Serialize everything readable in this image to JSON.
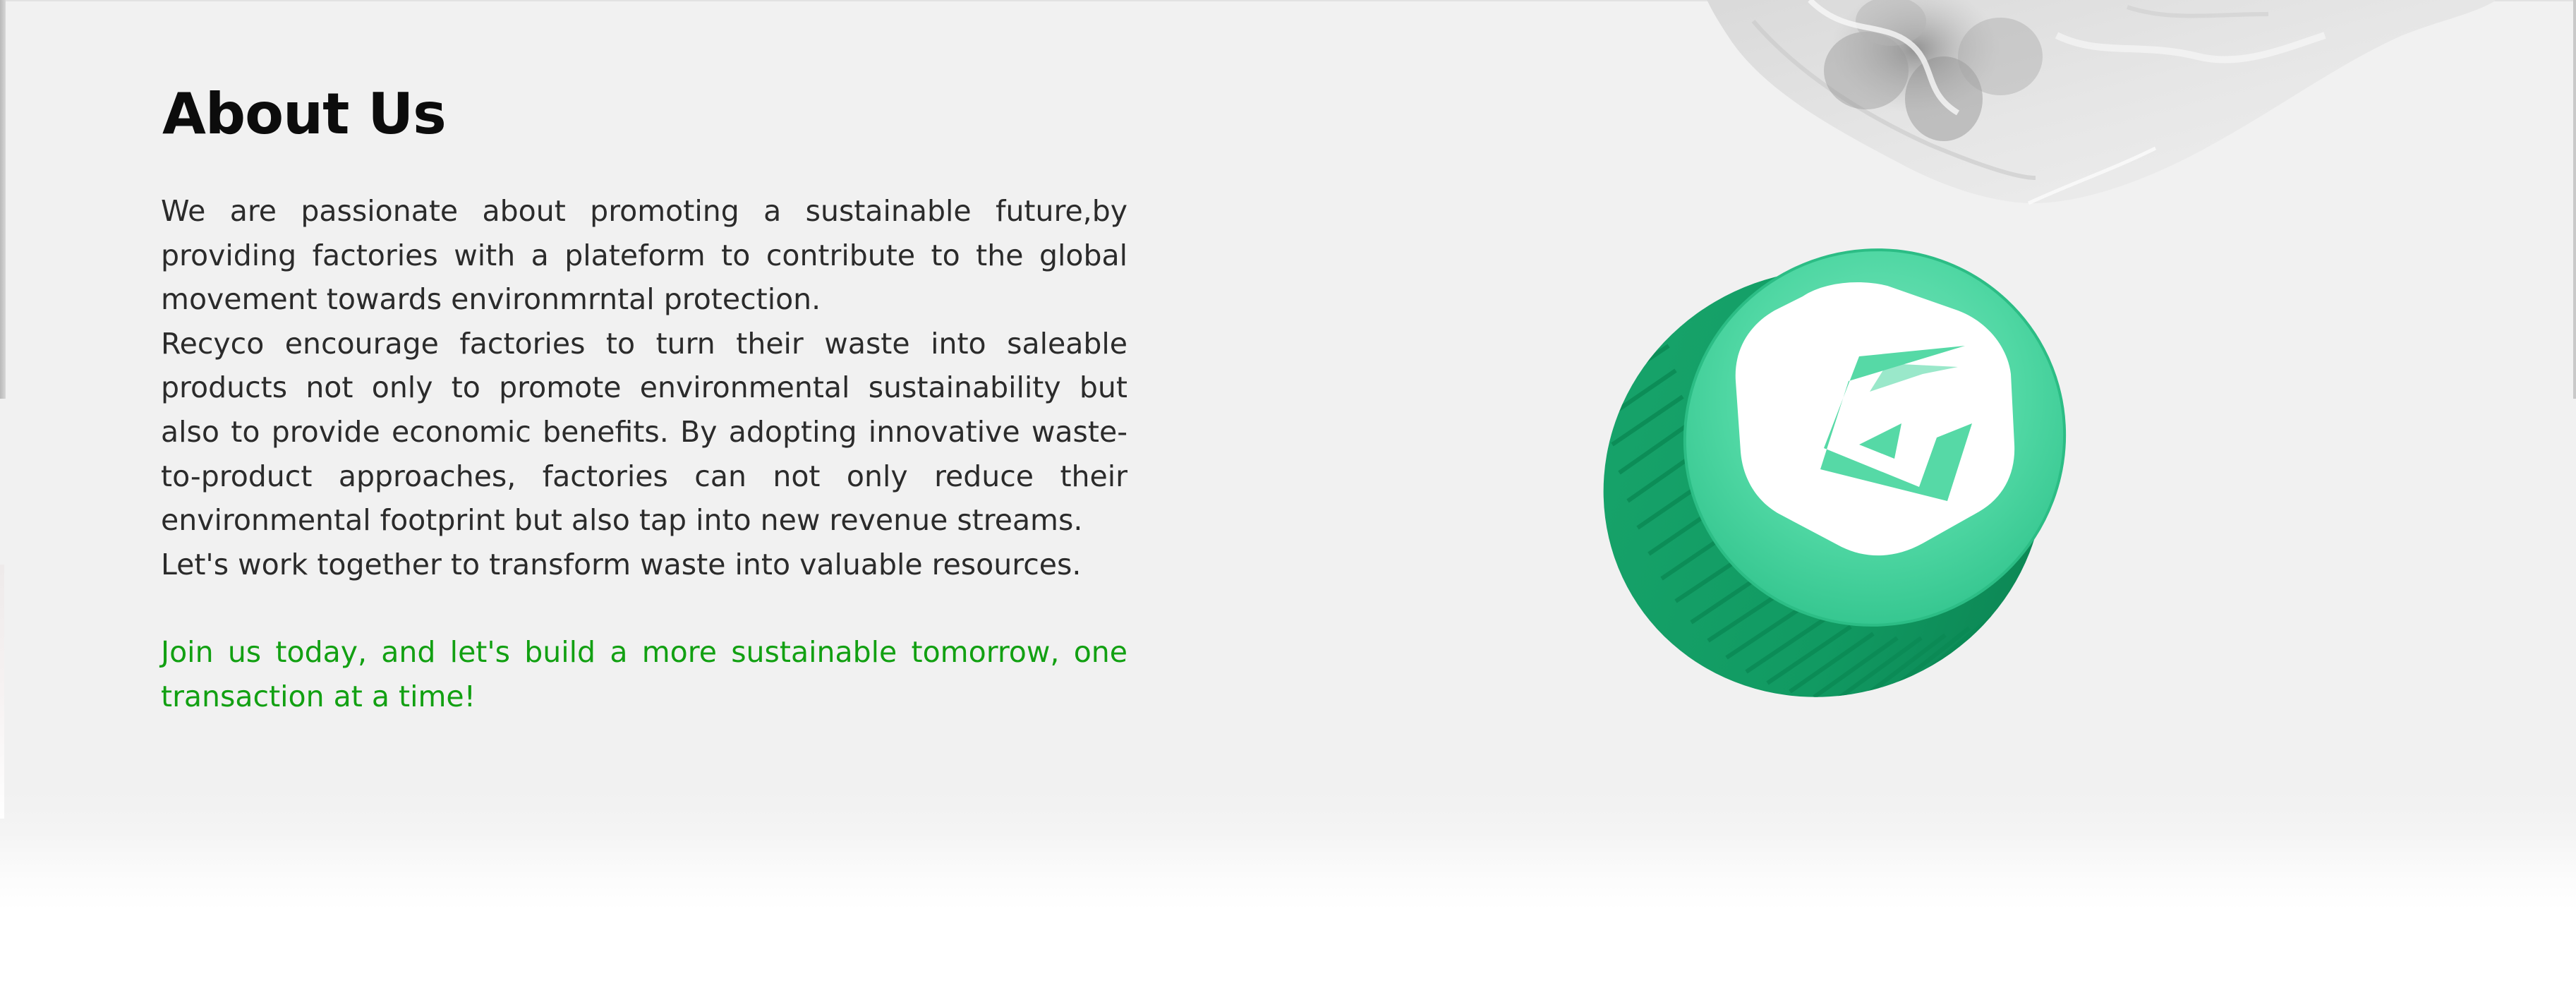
{
  "about": {
    "title": "About Us",
    "paragraphs": [
      "We are passionate about promoting a sustainable future,by providing factories with a plateform to contribute to the global movement towards environmrntal protection.",
      "Recyco encourage factories to turn their waste into saleable products not only to promote environmental sustainability but also to provide economic benefits. By adopting innovative waste-to-product approaches, factories can not only reduce their environmental footprint but also tap into new revenue streams.",
      "Let's work together to transform waste into valuable resources."
    ],
    "cta": "Join us today, and let's build a more sustainable tomorrow, one transaction at a time!"
  },
  "images": {
    "bag": "crumpled-plastic-bag-image",
    "cap": "green-bottle-cap-logo-image"
  },
  "colors": {
    "section_bg": "#f1f1f1",
    "heading": "#0c0c0c",
    "body_text": "#2b2b2b",
    "cta_text": "#12a012",
    "cap_green": "#1fb37a",
    "cap_light": "#5fdcae"
  }
}
